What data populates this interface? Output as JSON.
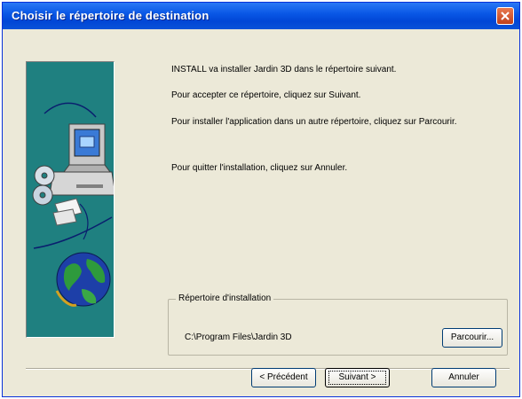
{
  "window": {
    "title": "Choisir le répertoire de destination"
  },
  "content": {
    "line1": "INSTALL va installer Jardin 3D dans le répertoire suivant.",
    "line2": "Pour accepter ce répertoire, cliquez sur Suivant.",
    "line3": "Pour installer l'application dans un autre répertoire, cliquez sur Parcourir.",
    "line4": "Pour quitter l'installation, cliquez sur Annuler."
  },
  "destination": {
    "legend": "Répertoire d'installation",
    "path": "C:\\Program Files\\Jardin 3D",
    "browse_label": "Parcourir..."
  },
  "buttons": {
    "prev_label": "< Précédent",
    "next_label": "Suivant >",
    "cancel_label": "Annuler"
  },
  "colors": {
    "titlebar": "#0a58e6",
    "panel": "#1f8080",
    "dialog_bg": "#ece9d8"
  },
  "icons": {
    "close": "close-icon",
    "illustration": "computer-globe-illustration"
  }
}
